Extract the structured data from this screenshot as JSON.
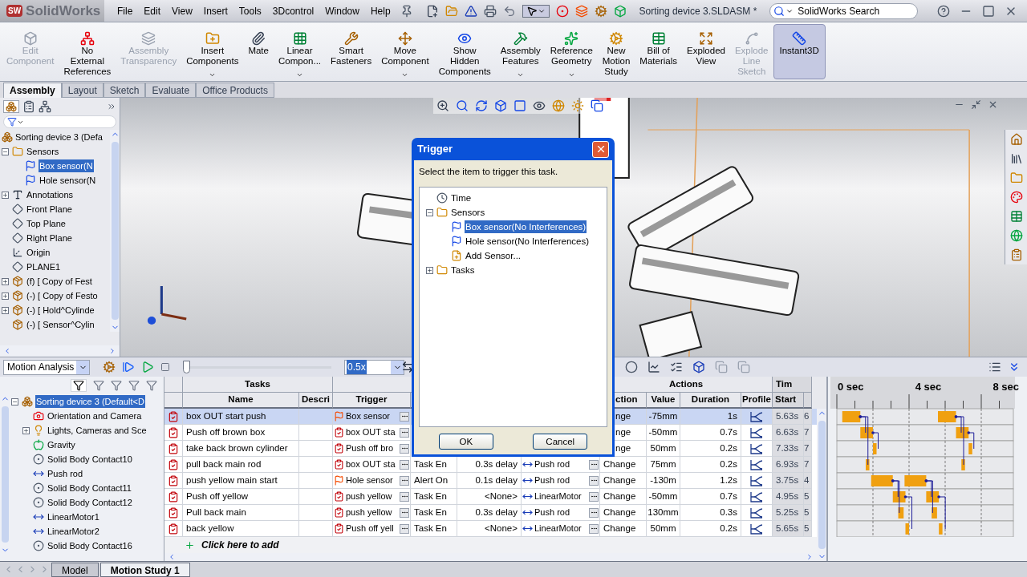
{
  "app": {
    "logo_badge": "SW",
    "logo_name": "SolidWorks",
    "menus": [
      "File",
      "Edit",
      "View",
      "Insert",
      "Tools",
      "3Dcontrol",
      "Window",
      "Help"
    ],
    "document_title": "Sorting device 3.SLDASM *",
    "search": {
      "placeholder": "SolidWorks Search"
    }
  },
  "ribbon": [
    {
      "label": [
        "Edit",
        "Component"
      ],
      "disabled": true,
      "dropdown": false,
      "selected": false
    },
    {
      "label": [
        "No",
        "External",
        "References"
      ],
      "disabled": false,
      "dropdown": false,
      "selected": false
    },
    {
      "label": [
        "Assembly",
        "Transparency"
      ],
      "disabled": true,
      "dropdown": false,
      "selected": false
    },
    {
      "label": [
        "Insert",
        "Components"
      ],
      "disabled": false,
      "dropdown": true,
      "selected": false
    },
    {
      "label": [
        "Mate"
      ],
      "disabled": false,
      "dropdown": false,
      "selected": false
    },
    {
      "label": [
        "Linear",
        "Compon..."
      ],
      "disabled": false,
      "dropdown": true,
      "selected": false
    },
    {
      "label": [
        "Smart",
        "Fasteners"
      ],
      "disabled": false,
      "dropdown": false,
      "selected": false
    },
    {
      "label": [
        "Move",
        "Component"
      ],
      "disabled": false,
      "dropdown": true,
      "selected": false
    },
    {
      "label": [
        "Show",
        "Hidden",
        "Components"
      ],
      "disabled": false,
      "dropdown": false,
      "selected": false
    },
    {
      "label": [
        "Assembly",
        "Features"
      ],
      "disabled": false,
      "dropdown": true,
      "selected": false
    },
    {
      "label": [
        "Reference",
        "Geometry"
      ],
      "disabled": false,
      "dropdown": true,
      "selected": false
    },
    {
      "label": [
        "New",
        "Motion",
        "Study"
      ],
      "disabled": false,
      "dropdown": false,
      "selected": false
    },
    {
      "label": [
        "Bill of",
        "Materials"
      ],
      "disabled": false,
      "dropdown": false,
      "selected": false
    },
    {
      "label": [
        "Exploded",
        "View"
      ],
      "disabled": false,
      "dropdown": false,
      "selected": false
    },
    {
      "label": [
        "Explode",
        "Line",
        "Sketch"
      ],
      "disabled": true,
      "dropdown": false,
      "selected": false
    },
    {
      "label": [
        "Instant3D"
      ],
      "disabled": false,
      "dropdown": false,
      "selected": true
    }
  ],
  "command_tabs": [
    {
      "label": "Assembly",
      "selected": true
    },
    {
      "label": "Layout",
      "selected": false
    },
    {
      "label": "Sketch",
      "selected": false
    },
    {
      "label": "Evaluate",
      "selected": false
    },
    {
      "label": "Office Products",
      "selected": false
    }
  ],
  "feature_tree": {
    "items": [
      {
        "label": "Sorting device 3 (Defa",
        "kind": "assembly",
        "selected": false,
        "children": [
          {
            "label": "Sensors",
            "kind": "folder",
            "selected": false,
            "expanded": true,
            "children": [
              {
                "label": "Box sensor(N",
                "kind": "sensor",
                "selected": true
              },
              {
                "label": "Hole sensor(N",
                "kind": "sensor",
                "selected": false
              }
            ]
          },
          {
            "label": "Annotations",
            "kind": "annotations",
            "selected": false,
            "expanded": false
          },
          {
            "label": "Front Plane",
            "kind": "plane",
            "selected": false
          },
          {
            "label": "Top Plane",
            "kind": "plane",
            "selected": false
          },
          {
            "label": "Right Plane",
            "kind": "plane",
            "selected": false
          },
          {
            "label": "Origin",
            "kind": "origin",
            "selected": false
          },
          {
            "label": "PLANE1",
            "kind": "plane",
            "selected": false
          },
          {
            "label": "(f) [ Copy of Fest",
            "kind": "component",
            "selected": false,
            "expanded": false
          },
          {
            "label": "(-) [ Copy of Festo",
            "kind": "component",
            "selected": false,
            "expanded": false
          },
          {
            "label": "(-) [ Hold^Cylinde",
            "kind": "component",
            "selected": false,
            "expanded": false
          },
          {
            "label": "(-) [ Sensor^Cylin",
            "kind": "component",
            "selected": false
          }
        ]
      }
    ]
  },
  "trigger_dialog": {
    "title": "Trigger",
    "prompt": "Select the item to trigger this task.",
    "items": [
      {
        "label": "Time",
        "kind": "time",
        "selected": false
      },
      {
        "label": "Sensors",
        "kind": "folder",
        "selected": false,
        "expanded": true,
        "children": [
          {
            "label": "Box sensor(No Interferences)",
            "kind": "sensor",
            "selected": true
          },
          {
            "label": "Hole sensor(No Interferences)",
            "kind": "sensor",
            "selected": false
          },
          {
            "label": "Add Sensor...",
            "kind": "add",
            "selected": false
          }
        ]
      },
      {
        "label": "Tasks",
        "kind": "folder",
        "selected": false,
        "expanded": false
      }
    ],
    "buttons": [
      "OK",
      "Cancel"
    ]
  },
  "motion_toolbar": {
    "study_type": "Motion Analysis",
    "time_slider": {
      "level": 0
    },
    "playback_speed": "0.5x"
  },
  "motion_tree": {
    "items": [
      {
        "label": "Sorting device 3 (Default<D",
        "kind": "assembly",
        "selected": true,
        "expanded": true,
        "children": [
          {
            "label": "Orientation and Camera",
            "kind": "camera",
            "selected": false
          },
          {
            "label": "Lights, Cameras and Sce",
            "kind": "lights",
            "selected": false,
            "expanded": false
          },
          {
            "label": "Gravity",
            "kind": "gravity",
            "selected": false
          },
          {
            "label": "Solid Body Contact10",
            "kind": "contact",
            "selected": false
          },
          {
            "label": "Push rod",
            "kind": "motor",
            "selected": false
          },
          {
            "label": "Solid Body Contact11",
            "kind": "contact",
            "selected": false
          },
          {
            "label": "Solid Body Contact12",
            "kind": "contact",
            "selected": false
          },
          {
            "label": "LinearMotor1",
            "kind": "motor",
            "selected": false
          },
          {
            "label": "LinearMotor2",
            "kind": "motor",
            "selected": false
          },
          {
            "label": "Solid Body Contact16",
            "kind": "contact",
            "selected": false
          }
        ]
      }
    ]
  },
  "task_table": {
    "groups": {
      "tasks": "Tasks",
      "actions": "Actions",
      "time": "Tim"
    },
    "columns": {
      "name": "Name",
      "description": "Descri",
      "trigger": "Trigger",
      "action": "ction",
      "value": "Value",
      "duration": "Duration",
      "profile": "Profile",
      "start": "Start"
    },
    "rows": [
      {
        "name": "box OUT start push",
        "trigger": {
          "label": "Box sensor",
          "kind": "sensor"
        },
        "action": "nge",
        "value": "-75mm",
        "duration": "1s",
        "start": "5.63s",
        "column_14": "6",
        "selected": true
      },
      {
        "name": "Push off brown box",
        "trigger": {
          "label": "box OUT sta",
          "kind": "task"
        },
        "action": "nge",
        "value": "-50mm",
        "duration": "0.7s",
        "start": "6.63s",
        "column_14": "7",
        "selected": false
      },
      {
        "name": "take back brown cylinder",
        "trigger": {
          "label": "Push off bro",
          "kind": "task"
        },
        "action": "nge",
        "value": "50mm",
        "duration": "0.2s",
        "start": "7.33s",
        "column_14": "7",
        "selected": false
      },
      {
        "name": "pull back main rod",
        "trigger": {
          "label": "box OUT sta",
          "kind": "task"
        },
        "condition": "Task En",
        "delay": "0.3s delay",
        "feature": "Push rod",
        "action": "Change",
        "value": "75mm",
        "duration": "0.2s",
        "start": "6.93s",
        "column_14": "7",
        "selected": false
      },
      {
        "name": "push yellow main start",
        "trigger": {
          "label": "Hole sensor",
          "kind": "sensor"
        },
        "condition": "Alert On",
        "delay": "0.1s delay",
        "feature": "Push rod",
        "action": "Change",
        "value": "-130m",
        "duration": "1.2s",
        "start": "3.75s",
        "column_14": "4",
        "selected": false
      },
      {
        "name": "Push off yellow",
        "trigger": {
          "label": "push yellow",
          "kind": "task"
        },
        "condition": "Task En",
        "delay": "<None>",
        "feature": "LinearMotor",
        "action": "Change",
        "value": "-50mm",
        "duration": "0.7s",
        "start": "4.95s",
        "column_14": "5",
        "selected": false
      },
      {
        "name": "Pull back main",
        "trigger": {
          "label": "push yellow",
          "kind": "task"
        },
        "condition": "Task En",
        "delay": "0.3s delay",
        "feature": "Push rod",
        "action": "Change",
        "value": "130mm",
        "duration": "0.3s",
        "start": "5.25s",
        "column_14": "5",
        "selected": false
      },
      {
        "name": "back yellow",
        "trigger": {
          "label": "Push off yell",
          "kind": "task"
        },
        "condition": "Task En",
        "delay": "<None>",
        "feature": "LinearMotor",
        "action": "Change",
        "value": "50mm",
        "duration": "0.2s",
        "start": "5.65s",
        "column_14": "5",
        "selected": false
      }
    ],
    "add_row": "Click here to add"
  },
  "timeline": {
    "tick_labels": [
      "0 sec",
      "4 sec",
      "8 sec"
    ]
  },
  "bottom_tabs": [
    {
      "label": "Model",
      "selected": false
    },
    {
      "label": "Motion Study 1",
      "selected": true
    }
  ]
}
